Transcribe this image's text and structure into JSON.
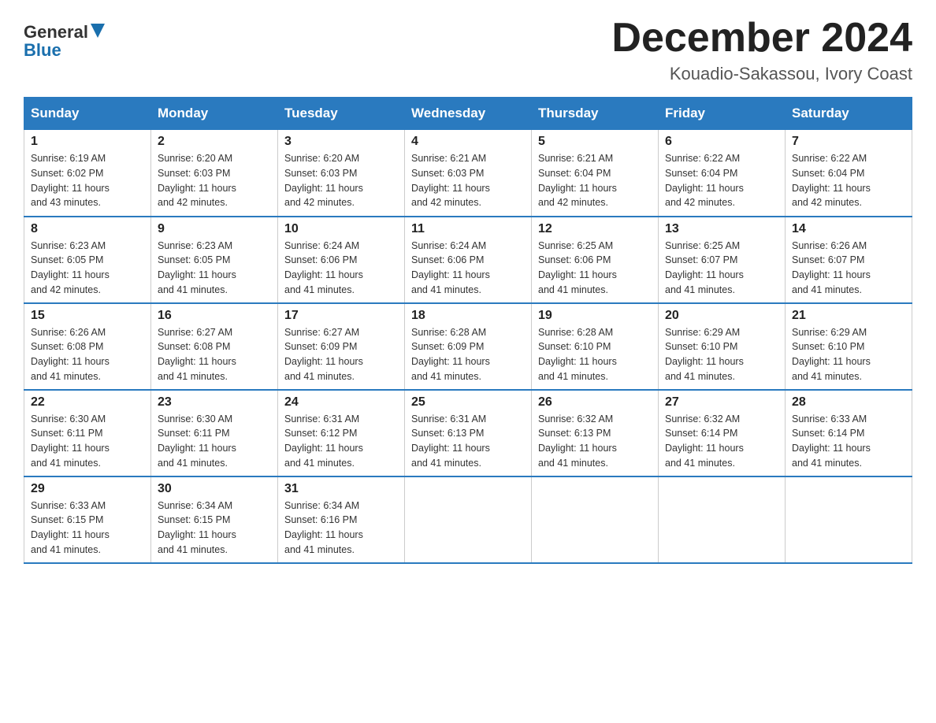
{
  "logo": {
    "text1": "General",
    "text2": "Blue"
  },
  "title": "December 2024",
  "subtitle": "Kouadio-Sakassou, Ivory Coast",
  "days_of_week": [
    "Sunday",
    "Monday",
    "Tuesday",
    "Wednesday",
    "Thursday",
    "Friday",
    "Saturday"
  ],
  "weeks": [
    [
      {
        "day": "1",
        "sunrise": "6:19 AM",
        "sunset": "6:02 PM",
        "daylight": "11 hours and 43 minutes."
      },
      {
        "day": "2",
        "sunrise": "6:20 AM",
        "sunset": "6:03 PM",
        "daylight": "11 hours and 42 minutes."
      },
      {
        "day": "3",
        "sunrise": "6:20 AM",
        "sunset": "6:03 PM",
        "daylight": "11 hours and 42 minutes."
      },
      {
        "day": "4",
        "sunrise": "6:21 AM",
        "sunset": "6:03 PM",
        "daylight": "11 hours and 42 minutes."
      },
      {
        "day": "5",
        "sunrise": "6:21 AM",
        "sunset": "6:04 PM",
        "daylight": "11 hours and 42 minutes."
      },
      {
        "day": "6",
        "sunrise": "6:22 AM",
        "sunset": "6:04 PM",
        "daylight": "11 hours and 42 minutes."
      },
      {
        "day": "7",
        "sunrise": "6:22 AM",
        "sunset": "6:04 PM",
        "daylight": "11 hours and 42 minutes."
      }
    ],
    [
      {
        "day": "8",
        "sunrise": "6:23 AM",
        "sunset": "6:05 PM",
        "daylight": "11 hours and 42 minutes."
      },
      {
        "day": "9",
        "sunrise": "6:23 AM",
        "sunset": "6:05 PM",
        "daylight": "11 hours and 41 minutes."
      },
      {
        "day": "10",
        "sunrise": "6:24 AM",
        "sunset": "6:06 PM",
        "daylight": "11 hours and 41 minutes."
      },
      {
        "day": "11",
        "sunrise": "6:24 AM",
        "sunset": "6:06 PM",
        "daylight": "11 hours and 41 minutes."
      },
      {
        "day": "12",
        "sunrise": "6:25 AM",
        "sunset": "6:06 PM",
        "daylight": "11 hours and 41 minutes."
      },
      {
        "day": "13",
        "sunrise": "6:25 AM",
        "sunset": "6:07 PM",
        "daylight": "11 hours and 41 minutes."
      },
      {
        "day": "14",
        "sunrise": "6:26 AM",
        "sunset": "6:07 PM",
        "daylight": "11 hours and 41 minutes."
      }
    ],
    [
      {
        "day": "15",
        "sunrise": "6:26 AM",
        "sunset": "6:08 PM",
        "daylight": "11 hours and 41 minutes."
      },
      {
        "day": "16",
        "sunrise": "6:27 AM",
        "sunset": "6:08 PM",
        "daylight": "11 hours and 41 minutes."
      },
      {
        "day": "17",
        "sunrise": "6:27 AM",
        "sunset": "6:09 PM",
        "daylight": "11 hours and 41 minutes."
      },
      {
        "day": "18",
        "sunrise": "6:28 AM",
        "sunset": "6:09 PM",
        "daylight": "11 hours and 41 minutes."
      },
      {
        "day": "19",
        "sunrise": "6:28 AM",
        "sunset": "6:10 PM",
        "daylight": "11 hours and 41 minutes."
      },
      {
        "day": "20",
        "sunrise": "6:29 AM",
        "sunset": "6:10 PM",
        "daylight": "11 hours and 41 minutes."
      },
      {
        "day": "21",
        "sunrise": "6:29 AM",
        "sunset": "6:10 PM",
        "daylight": "11 hours and 41 minutes."
      }
    ],
    [
      {
        "day": "22",
        "sunrise": "6:30 AM",
        "sunset": "6:11 PM",
        "daylight": "11 hours and 41 minutes."
      },
      {
        "day": "23",
        "sunrise": "6:30 AM",
        "sunset": "6:11 PM",
        "daylight": "11 hours and 41 minutes."
      },
      {
        "day": "24",
        "sunrise": "6:31 AM",
        "sunset": "6:12 PM",
        "daylight": "11 hours and 41 minutes."
      },
      {
        "day": "25",
        "sunrise": "6:31 AM",
        "sunset": "6:13 PM",
        "daylight": "11 hours and 41 minutes."
      },
      {
        "day": "26",
        "sunrise": "6:32 AM",
        "sunset": "6:13 PM",
        "daylight": "11 hours and 41 minutes."
      },
      {
        "day": "27",
        "sunrise": "6:32 AM",
        "sunset": "6:14 PM",
        "daylight": "11 hours and 41 minutes."
      },
      {
        "day": "28",
        "sunrise": "6:33 AM",
        "sunset": "6:14 PM",
        "daylight": "11 hours and 41 minutes."
      }
    ],
    [
      {
        "day": "29",
        "sunrise": "6:33 AM",
        "sunset": "6:15 PM",
        "daylight": "11 hours and 41 minutes."
      },
      {
        "day": "30",
        "sunrise": "6:34 AM",
        "sunset": "6:15 PM",
        "daylight": "11 hours and 41 minutes."
      },
      {
        "day": "31",
        "sunrise": "6:34 AM",
        "sunset": "6:16 PM",
        "daylight": "11 hours and 41 minutes."
      },
      null,
      null,
      null,
      null
    ]
  ]
}
